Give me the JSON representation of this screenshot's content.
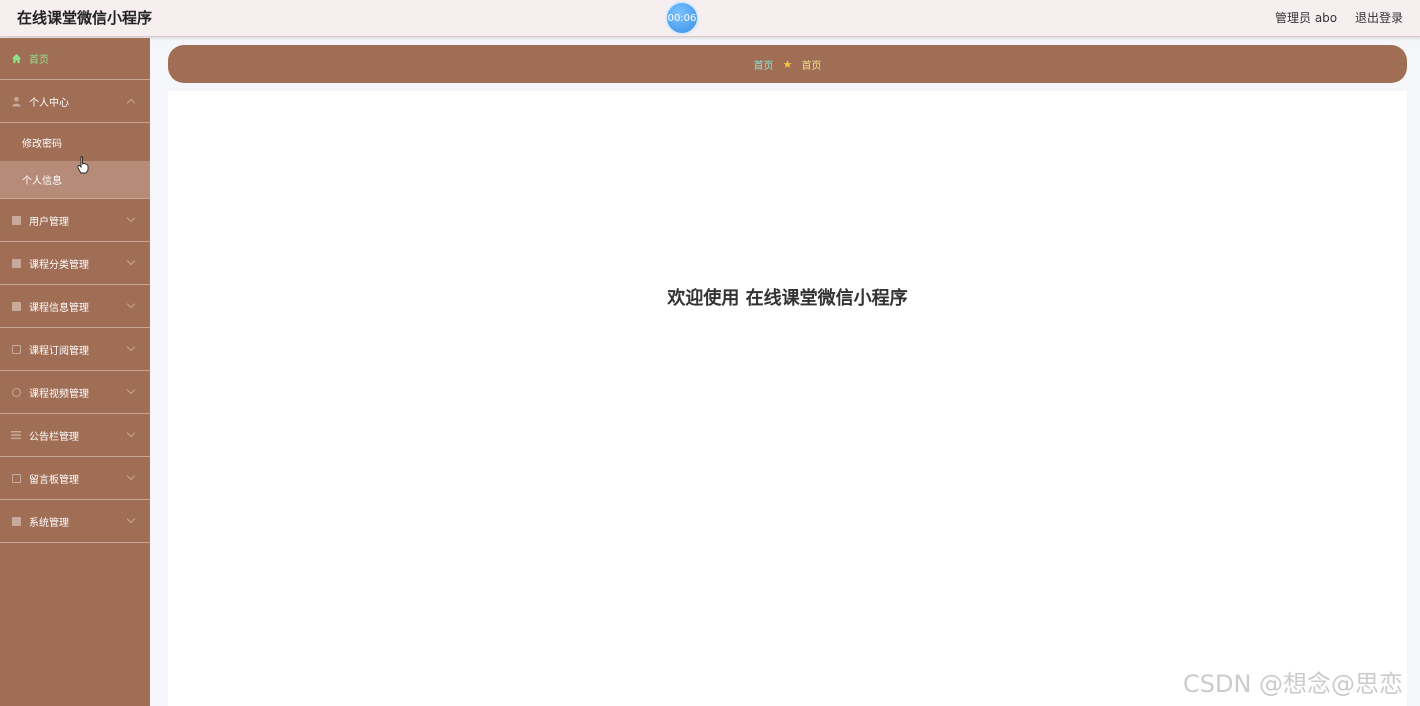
{
  "header": {
    "title": "在线课堂微信小程序",
    "timer": "00:06",
    "admin": "管理员 abo",
    "logout": "退出登录"
  },
  "sidebar": {
    "home": "首页",
    "personal_center": "个人中心",
    "sub_items": [
      "修改密码",
      "个人信息"
    ],
    "items": [
      {
        "label": "用户管理",
        "icon": "user-list-icon"
      },
      {
        "label": "课程分类管理",
        "icon": "clipboard-icon"
      },
      {
        "label": "课程信息管理",
        "icon": "folder-icon"
      },
      {
        "label": "课程订阅管理",
        "icon": "frame-icon"
      },
      {
        "label": "课程视频管理",
        "icon": "globe-icon"
      },
      {
        "label": "公告栏管理",
        "icon": "list-icon"
      },
      {
        "label": "留言板管理",
        "icon": "message-icon"
      },
      {
        "label": "系统管理",
        "icon": "settings-icon"
      }
    ]
  },
  "breadcrumb": {
    "first": "首页",
    "second": "首页"
  },
  "main": {
    "welcome": "欢迎使用 在线课堂微信小程序"
  },
  "watermark": "CSDN @想念@思恋",
  "colors": {
    "sidebar_bg": "#a06d55",
    "home_text": "#8fe08a",
    "active_sub_bg": "#b68c78"
  }
}
